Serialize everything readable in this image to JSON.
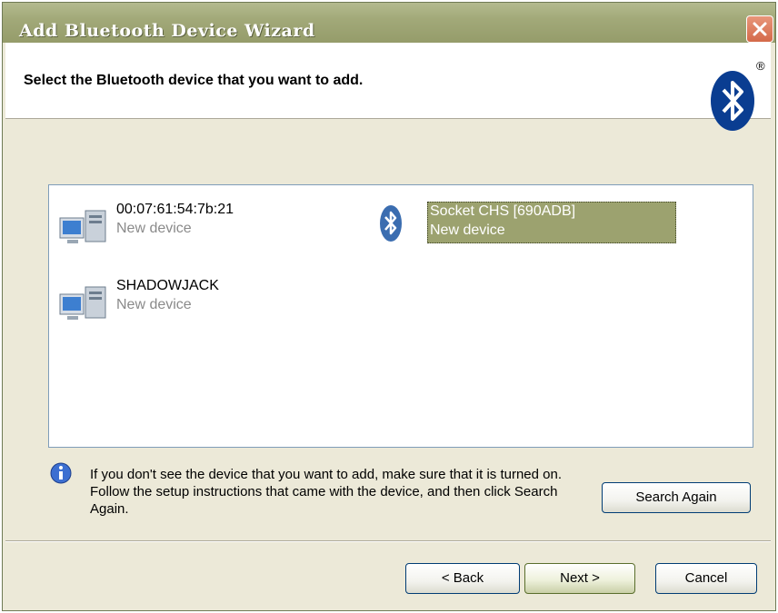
{
  "window": {
    "title": "Add Bluetooth Device Wizard"
  },
  "header": {
    "title": "Select the Bluetooth device that you want to add.",
    "registered_mark": "®"
  },
  "devices": [
    {
      "name": "00:07:61:54:7b:21",
      "status": "New device",
      "icon": "computer-icon",
      "selected": false
    },
    {
      "name": "Socket CHS [690ADB]",
      "status": "New device",
      "icon": "bluetooth-icon",
      "selected": true
    },
    {
      "name": "SHADOWJACK",
      "status": "New device",
      "icon": "computer-icon",
      "selected": false
    }
  ],
  "info": {
    "icon": "info-icon",
    "text": "If you don't see the device that you want to add, make sure that it is turned on. Follow the setup instructions that came with the device, and then click Search Again."
  },
  "buttons": {
    "search_again": "Search Again",
    "back": "< Back",
    "next": "Next >",
    "cancel": "Cancel"
  },
  "colors": {
    "title_bar": "#a2a979",
    "selection": "#9ca26f",
    "bluetooth_blue": "#0a3d91"
  }
}
